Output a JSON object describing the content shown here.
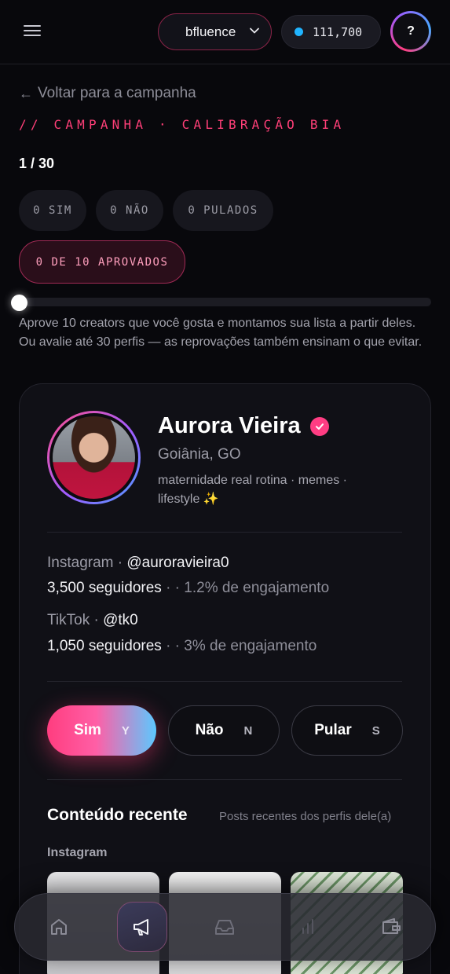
{
  "header": {
    "brand": "bfluence",
    "credits": "111,700",
    "help_label": "?"
  },
  "campaign": {
    "back_label": "Voltar para a campanha",
    "eyebrow": "// CAMPANHA · CALIBRAÇÃO BIA",
    "progress_count": "1 / 30",
    "pills": {
      "yes": "0 SIM",
      "no": "0 NÃO",
      "skipped": "0 PULADOS",
      "approved": "0 DE 10 APROVADOS"
    },
    "progress_fraction": 0.0,
    "hint": "Aprove 10 creators que você gosta e montamos sua lista a partir deles. Ou avalie até 30 perfis — as reprovações também ensinam o que evitar."
  },
  "creator": {
    "name": "Aurora Vieira",
    "location": "Goiânia, GO",
    "bio": "maternidade real rotina · memes · lifestyle ✨",
    "instagram": {
      "platform": "Instagram",
      "handle": "@auroravieira0",
      "followers": "3,500 seguidores",
      "engagement": "1.2% de engajamento"
    },
    "tiktok": {
      "platform": "TikTok",
      "handle": "@tk0",
      "followers": "1,050 seguidores",
      "engagement": "3% de engajamento"
    }
  },
  "actions": {
    "yes_label": "Sim",
    "yes_key": "Y",
    "no_label": "Não",
    "no_key": "N",
    "skip_label": "Pular",
    "skip_key": "S"
  },
  "recent": {
    "title": "Conteúdo recente",
    "subtitle": "Posts recentes dos perfis dele(a)",
    "platform": "Instagram"
  },
  "nav": {
    "items": [
      "home-icon",
      "megaphone-icon",
      "inbox-icon",
      "chart-icon",
      "wallet-icon"
    ],
    "active": "megaphone-icon"
  },
  "colors": {
    "accent": "#ff3f78",
    "credit_dot": "#20b4ff"
  }
}
